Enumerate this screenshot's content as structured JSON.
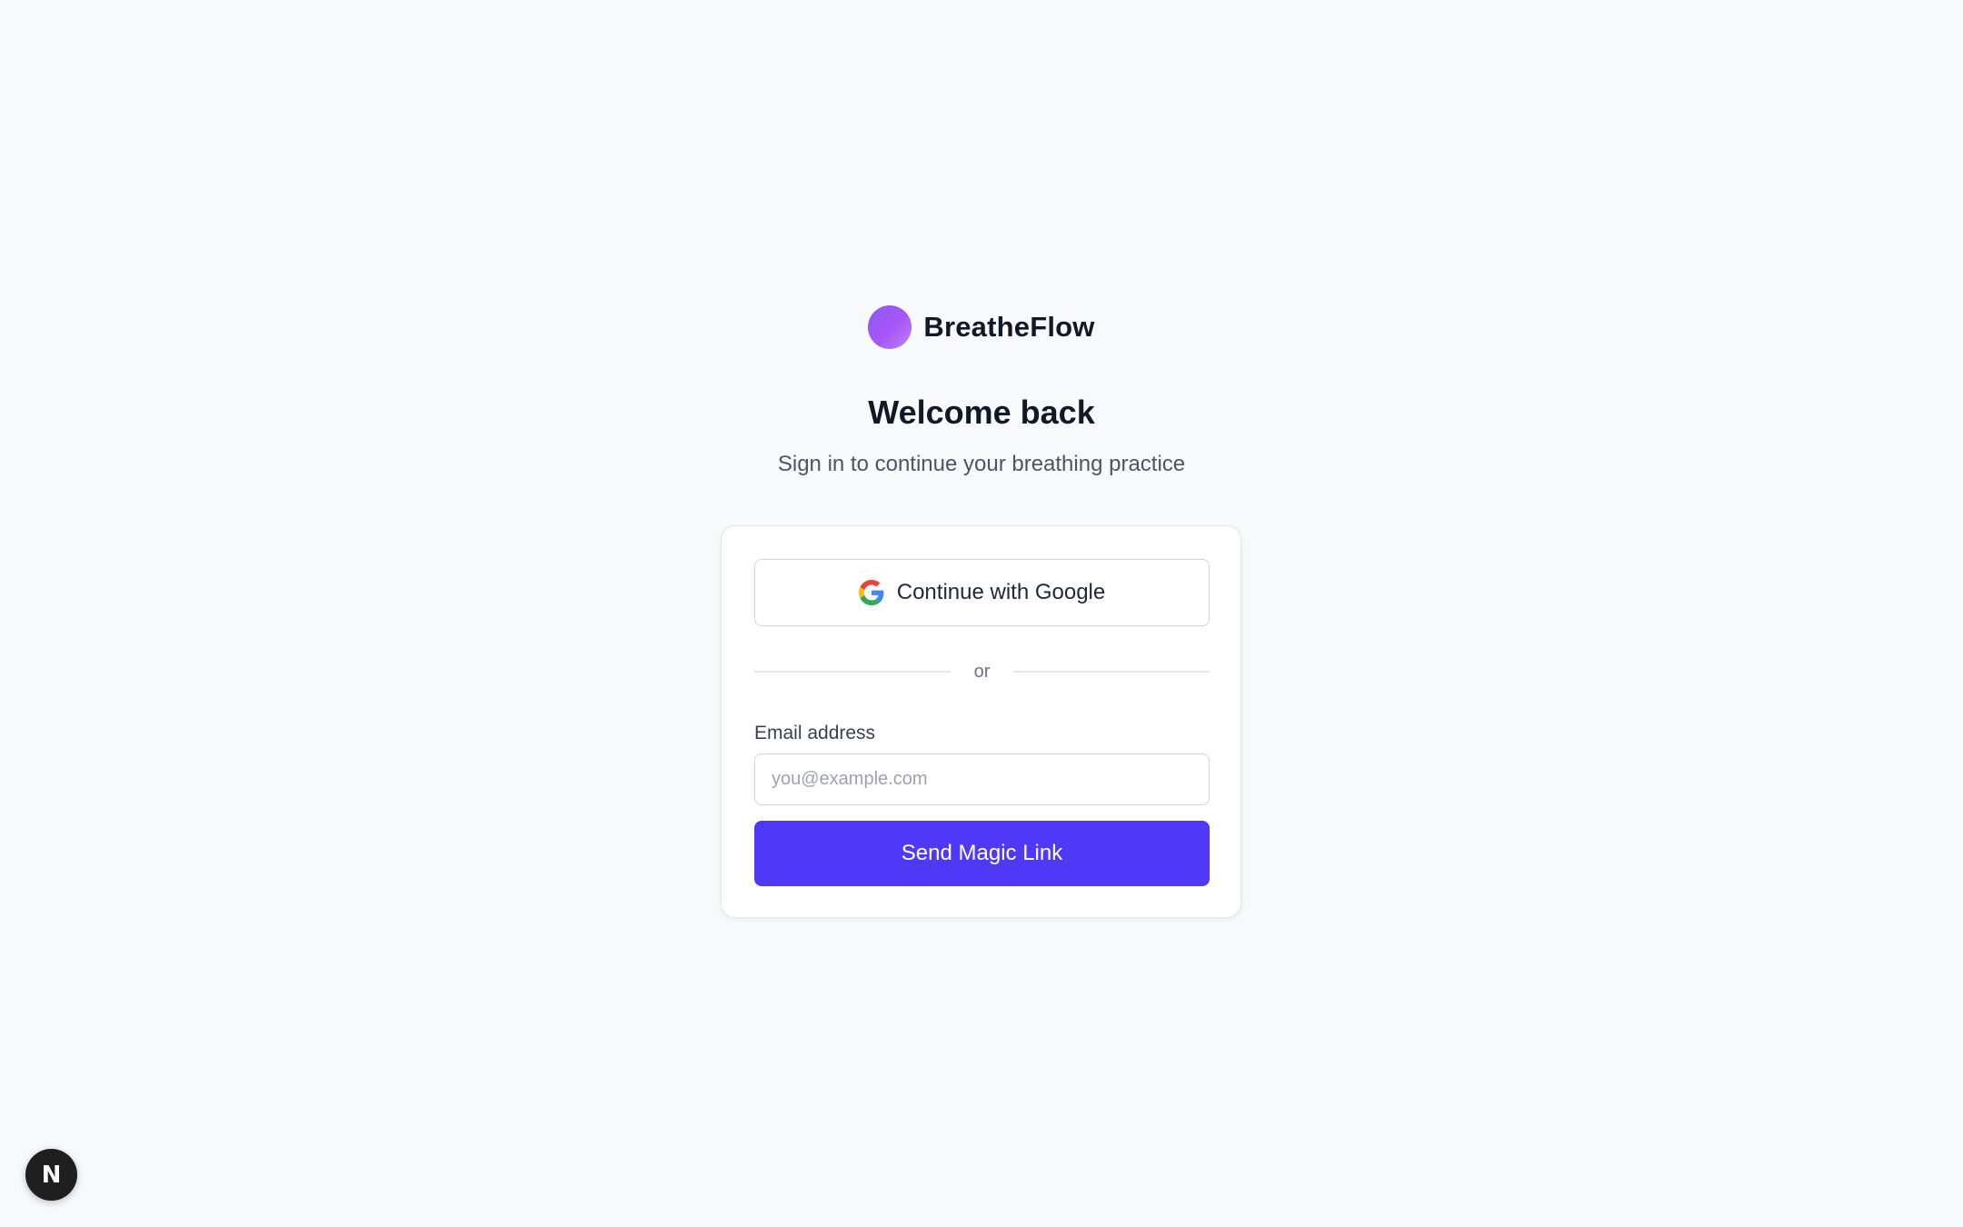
{
  "brand": {
    "name": "BreatheFlow"
  },
  "header": {
    "title": "Welcome back",
    "subtitle": "Sign in to continue your breathing practice"
  },
  "auth": {
    "google_label": "Continue with Google",
    "divider_text": "or",
    "email_label": "Email address",
    "email_placeholder": "you@example.com",
    "email_value": "",
    "submit_label": "Send Magic Link"
  },
  "dev_badge": {
    "letter": "N",
    "icon": "nextjs-icon"
  },
  "colors": {
    "background": "#f8f9fb",
    "primary_button": "#4f39f6",
    "logo_gradient_start": "#8b5cf6",
    "logo_gradient_end": "#c084fc"
  }
}
